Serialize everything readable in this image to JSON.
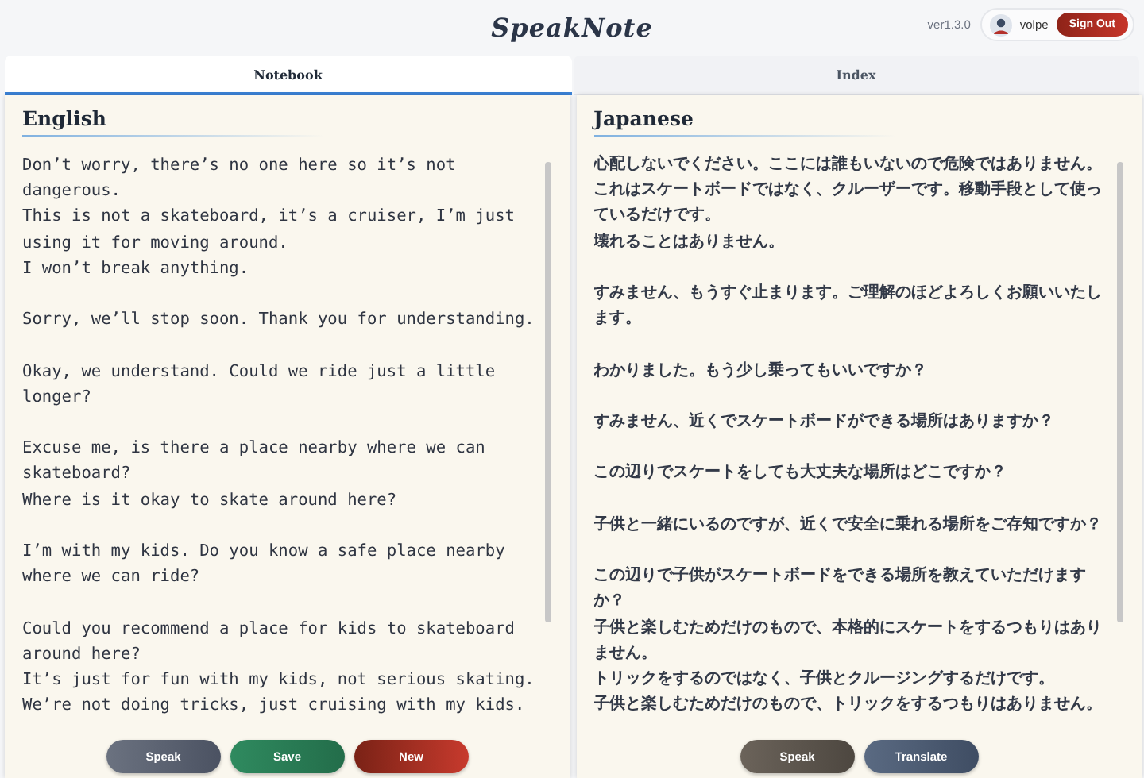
{
  "app": {
    "title": "SpeakNote",
    "version": "ver1.3.0"
  },
  "user": {
    "name": "volpe",
    "sign_out": "Sign Out"
  },
  "tabs": [
    {
      "label": "Notebook",
      "selected": true
    },
    {
      "label": "Index",
      "selected": false
    }
  ],
  "panels": [
    {
      "heading": "English",
      "kind": "latin",
      "paragraphs": [
        [
          "Don’t worry, there’s no one here so it’s not dangerous.",
          "This is not a skateboard, it’s a cruiser, I’m just using it for moving around.",
          "I won’t break anything."
        ],
        [
          "Sorry, we’ll stop soon. Thank you for understanding."
        ],
        [
          "Okay, we understand. Could we ride just a little longer?"
        ],
        [
          "Excuse me, is there a place nearby where we can skateboard?",
          "Where is it okay to skate around here?"
        ],
        [
          "I’m with my kids. Do you know a safe place nearby where we can ride?"
        ],
        [
          "Could you recommend a place for kids to skateboard around here?",
          "It’s just for fun with my kids, not serious skating.",
          "We’re not doing tricks, just cruising with my kids."
        ]
      ],
      "buttons": [
        {
          "label": "Speak",
          "kind": "speak"
        },
        {
          "label": "Save",
          "kind": "save"
        },
        {
          "label": "New",
          "kind": "new"
        }
      ]
    },
    {
      "heading": "Japanese",
      "kind": "cjk",
      "paragraphs": [
        [
          "心配しないでください。ここには誰もいないので危険ではありません。",
          "これはスケートボードではなく、クルーザーです。移動手段として使っているだけです。",
          "壊れることはありません。"
        ],
        [
          "すみません、もうすぐ止まります。ご理解のほどよろしくお願いいたします。"
        ],
        [
          "わかりました。もう少し乗ってもいいですか？"
        ],
        [
          "すみません、近くでスケートボードができる場所はありますか？"
        ],
        [
          "この辺りでスケートをしても大丈夫な場所はどこですか？"
        ],
        [
          "子供と一緒にいるのですが、近くで安全に乗れる場所をご存知ですか？"
        ],
        [
          "この辺りで子供がスケートボードをできる場所を教えていただけますか？",
          "子供と楽しむためだけのもので、本格的にスケートをするつもりはありません。",
          "トリックをするのではなく、子供とクルージングするだけです。",
          "子供と楽しむためだけのもので、トリックをするつもりはありません。"
        ]
      ],
      "buttons": [
        {
          "label": "Speak",
          "kind": "speak2"
        },
        {
          "label": "Translate",
          "kind": "translate"
        }
      ]
    }
  ]
}
